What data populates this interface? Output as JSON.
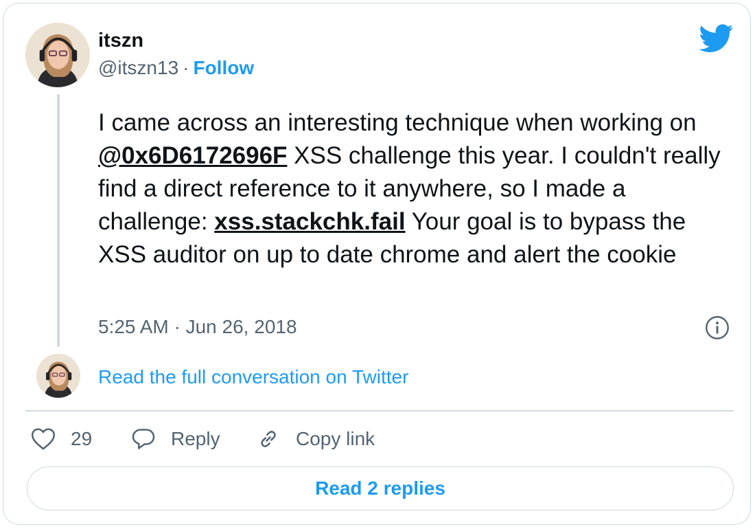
{
  "author": {
    "name": "itszn",
    "handle": "@itszn13",
    "separator": "·",
    "follow_label": "Follow"
  },
  "tweet": {
    "segments": {
      "t1": "I came across an interesting technique when working on ",
      "mention": "@0x6D6172696F",
      "t2": " XSS challenge this year. I couldn't really find a direct reference to it anywhere, so I made a challenge: ",
      "link": "xss.stackchk.fail",
      "t3": " Your goal is to bypass the XSS auditor on up to date chrome and alert the cookie"
    },
    "timestamp": "5:25 AM · Jun 26, 2018"
  },
  "conversation": {
    "read_full_label": "Read the full conversation on Twitter"
  },
  "actions": {
    "like_count": "29",
    "reply_label": "Reply",
    "copy_link_label": "Copy link"
  },
  "footer": {
    "read_replies_label": "Read 2 replies"
  },
  "icons": {
    "brand": "twitter-bird-icon",
    "info": "info-icon",
    "like": "heart-icon",
    "reply": "speech-bubble-icon",
    "copy": "link-icon"
  },
  "colors": {
    "accent": "#1d9bf0",
    "text": "#0f1419",
    "secondary": "#536471",
    "border": "#cfd9de"
  }
}
